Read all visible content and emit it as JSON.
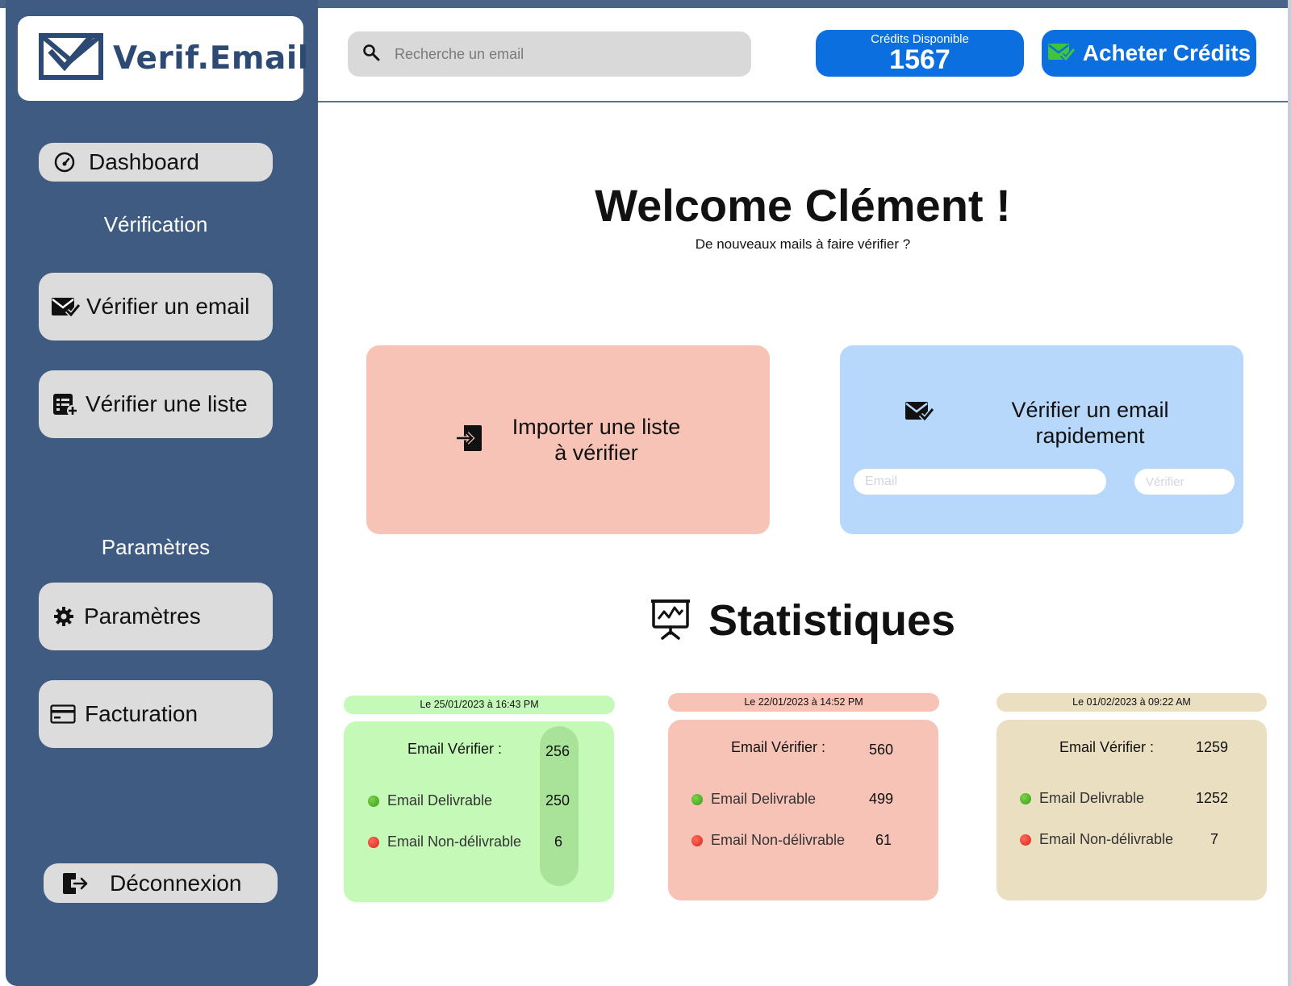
{
  "brand": {
    "logo_text": "Verif.Email"
  },
  "sidebar": {
    "dashboard": "Dashboard",
    "section_verification": "Vérification",
    "verify_email": "Vérifier un email",
    "verify_list": "Vérifier une liste",
    "section_settings": "Paramètres",
    "settings": "Paramètres",
    "billing": "Facturation",
    "logout": "Déconnexion"
  },
  "header": {
    "search_placeholder": "Recherche un email",
    "credits_label": "Crédits Disponible",
    "credits_value": "1567",
    "buy_label": "Acheter Crédits"
  },
  "main": {
    "welcome": "Welcome Clément !",
    "subtitle": "De nouveaux mails à faire vérifier ?",
    "import_card": {
      "line1": "Importer une liste",
      "line2": "à vérifier"
    },
    "quick_card": {
      "line1": "Vérifier un email",
      "line2": "rapidement",
      "email_placeholder": "Email",
      "verify_button": "Vérifier"
    },
    "stats_title": "Statistiques",
    "stats": [
      {
        "date": "Le 25/01/2023  à  16:43 PM",
        "verified_label": "Email Vérifier :",
        "verified": "256",
        "deliverable_label": "Email Delivrable",
        "deliverable": "250",
        "undeliverable_label": "Email Non-délivrable",
        "undeliverable": "6",
        "color": "#c4f9b8",
        "date_color": "#c4f9b8"
      },
      {
        "date": "Le 22/01/2023  à  14:52 PM",
        "verified_label": "Email Vérifier :",
        "verified": "560",
        "deliverable_label": "Email Delivrable",
        "deliverable": "499",
        "undeliverable_label": "Email Non-délivrable",
        "undeliverable": "61",
        "color": "#f6c3b6",
        "date_color": "#f6c3b6"
      },
      {
        "date": "Le 01/02/2023  à  09:22 AM",
        "verified_label": "Email Vérifier :",
        "verified": "1259",
        "deliverable_label": "Email Delivrable",
        "deliverable": "1252",
        "undeliverable_label": "Email Non-délivrable",
        "undeliverable": "7",
        "color": "#ebdfc2",
        "date_color": "#ebdfc2"
      }
    ]
  },
  "colors": {
    "sidebar_bg": "#3f5b82",
    "accent_blue": "#0c6fe0",
    "logo_navy": "#2c4a74",
    "import_card": "#f6c3b6",
    "quick_card": "#b7d7fb"
  }
}
